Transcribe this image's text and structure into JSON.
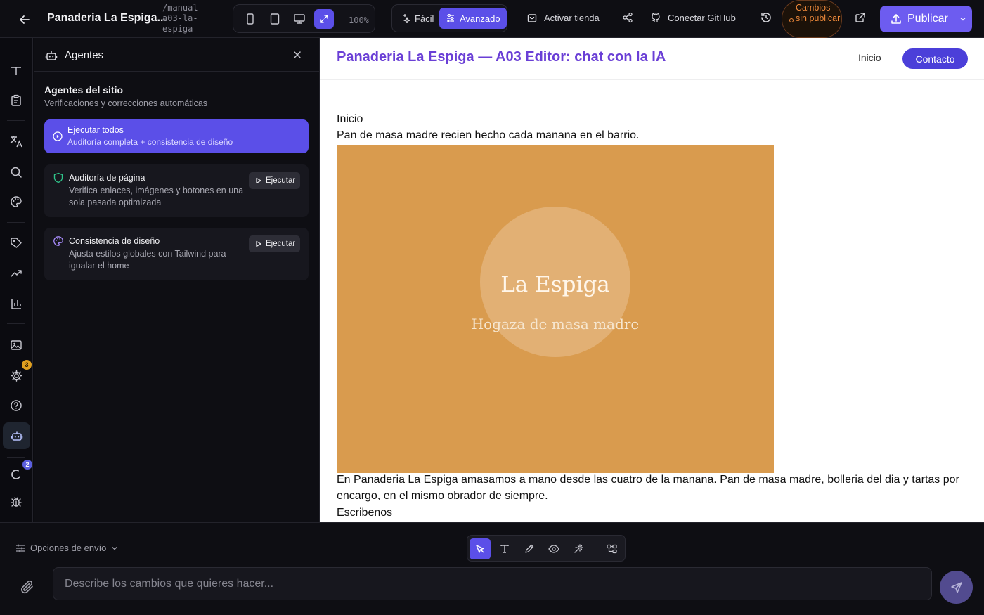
{
  "topbar": {
    "title": "Panaderia La Espiga...",
    "slug": "/manual-a03-la-espiga",
    "zoom": "100%",
    "mode_easy": "Fácil",
    "mode_advanced": "Avanzado",
    "activate_store": "Activar tienda",
    "connect_github": "Conectar GitHub",
    "unpublished": "Cambios sin publicar",
    "publish": "Publicar"
  },
  "rail": {
    "badges": {
      "settings": "3",
      "loading": "2"
    }
  },
  "agents_panel": {
    "title": "Agentes",
    "section_title": "Agentes del sitio",
    "section_subtitle": "Verificaciones y correcciones automáticas",
    "run_all": {
      "title": "Ejecutar todos",
      "subtitle": "Auditoría completa + consistencia de diseño"
    },
    "agents": [
      {
        "title": "Auditoría de página",
        "description": "Verifica enlaces, imágenes y botones en una sola pasada optimizada",
        "action": "Ejecutar",
        "icon": "shield-icon"
      },
      {
        "title": "Consistencia de diseño",
        "description": "Ajusta estilos globales con Tailwind para igualar el home",
        "action": "Ejecutar",
        "icon": "palette-icon"
      }
    ]
  },
  "preview": {
    "site_title": "Panaderia La Espiga — A03 Editor: chat con la IA",
    "nav": [
      "Inicio",
      "Contacto"
    ],
    "section_label": "Inicio",
    "tagline": "Pan de masa madre recien hecho cada manana en el barrio.",
    "hero_heading": "La Espiga",
    "hero_subheading": "Hogaza de masa madre",
    "body": "En Panaderia La Espiga amasamos a mano desde las cuatro de la manana. Pan de masa madre, bolleria del dia y tartas por encargo, en el mismo obrador de siempre.",
    "contact_heading": "Escribenos"
  },
  "composer": {
    "send_options": "Opciones de envío",
    "placeholder": "Describe los cambios que quieres hacer..."
  },
  "colors": {
    "accent": "#5b4fe8",
    "publish": "#6d5cf0",
    "warning": "#f08a3b",
    "hero_bg": "#d99b4e",
    "site_title": "#6a3fd6"
  }
}
